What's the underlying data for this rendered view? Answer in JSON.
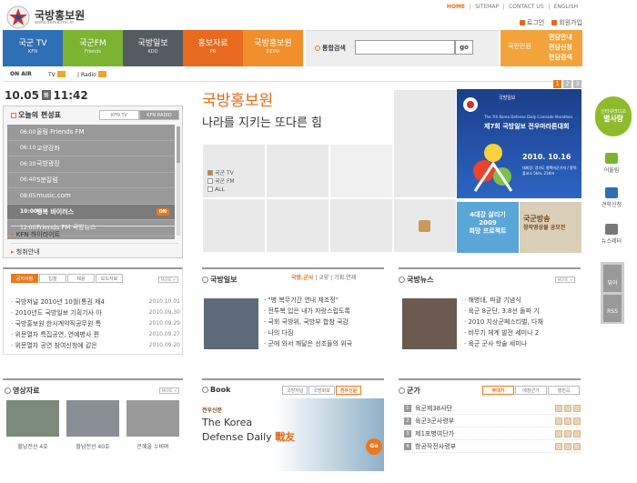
{
  "header": {
    "logo_text": "국방홍보원",
    "logo_url": "www.dema.mil.kr",
    "topnav": [
      "HOME",
      "SITEMAP",
      "CONTACT US",
      "ENGLISH"
    ],
    "login": "로그인",
    "join": "회원가입"
  },
  "menu": [
    {
      "label": "국군 TV",
      "sub": "KFN",
      "color": "#2f6fb5"
    },
    {
      "label": "국군FM",
      "sub": "Friends",
      "color": "#7cb432"
    },
    {
      "label": "국방일보",
      "sub": "KDD",
      "color": "#555b63"
    },
    {
      "label": "홍보자료",
      "sub": "PR",
      "color": "#e86a1e"
    },
    {
      "label": "국방홍보원",
      "sub": "DEMA",
      "color": "#f08f2c"
    }
  ],
  "search": {
    "label": "통합검색",
    "placeholder": "",
    "go": "go"
  },
  "civil": {
    "label": "국민민원",
    "lines": [
      "면담안내",
      "면담신청",
      "면담검색"
    ]
  },
  "onair": {
    "label": "ON AIR",
    "tv": "TV",
    "radio": "Radio"
  },
  "datetime": {
    "date": "10.05",
    "weekday": "화",
    "time": "11:42"
  },
  "schedule": {
    "title": "오늘의 편성표",
    "tabs": [
      "KFN TV",
      "KFN RADIO"
    ],
    "rows": [
      {
        "time": "06:00",
        "title": "울림 Friends FM"
      },
      {
        "time": "06:10",
        "title": "교양강좌"
      },
      {
        "time": "06:30",
        "title": "국방광장"
      },
      {
        "time": "06:40",
        "title": "5분칼럼"
      },
      {
        "time": "08:05",
        "title": "music.com"
      },
      {
        "time": "10:00",
        "title": "행복 바이러스",
        "badge": "ON"
      },
      {
        "time": "12:00",
        "title": "Friends FM 국방뉴스"
      }
    ],
    "links": [
      "KFN 하이라이트",
      "청취안내"
    ]
  },
  "hero": {
    "title": "국방홍보원",
    "subtitle": "나라를 지키는 또다른 힘",
    "filters": [
      "국군 TV",
      "국군 FM",
      "ALL"
    ],
    "pages": [
      "1",
      "2",
      "3"
    ],
    "poster1": {
      "org": "국방일보",
      "line1": "The 7th Korea Defense Daily Comrade Marathon",
      "line2": "제7회 국방일보 전우마라톤대회",
      "date": "2010. 10.16",
      "meta": "대회장: 경기도 평택미군기지 / 종목: 풀코스 5km, 21Km"
    },
    "poster2": {
      "line1": "4대강 살리기",
      "line2": "2009",
      "line3": "희망 프로젝트"
    },
    "poster3": {
      "line1": "국군방송",
      "line2": "창작영상물 공모전"
    }
  },
  "sidebar": {
    "radio_badge": {
      "line1": "인터넷라디오",
      "line2": "별사랑"
    },
    "items": [
      "어울림",
      "견학신청",
      "뉴스레터"
    ],
    "buttons": [
      "뷰어",
      "RSS"
    ]
  },
  "notice": {
    "tabs": [
      "공지사항",
      "입찰",
      "채용",
      "보도자료"
    ],
    "more": "MORE +",
    "items": [
      {
        "text": "국방저널 2010년 10월(통권 제4",
        "date": "2010.10.01"
      },
      {
        "text": "2010년도 국방일보 기획기사 아",
        "date": "2010.09.30"
      },
      {
        "text": "국방홍보원 한시계약직공무원 특",
        "date": "2010.09.29"
      },
      {
        "text": "위문열차 특집공연, 연예병사 편",
        "date": "2010.09.27"
      },
      {
        "text": "위문열차 공연 참여신청에 같은",
        "date": "2010.09.20"
      }
    ]
  },
  "paper": {
    "title": "국방일보",
    "cats": [
      "국방.군사",
      "교양",
      "기획.연재"
    ],
    "items": [
      "\"병 복무기간 연내 재조정\"",
      "전투복 입은 내가 자랑스럽도록",
      "국회 국방위, 국방부 합참 국감",
      "나의 다짐",
      "군에 와서 깨달은 선조들의 위국"
    ]
  },
  "news": {
    "title": "국방뉴스",
    "more": "MORE +",
    "items": [
      "해병대, 파괄 기념식",
      "육군 8군단, 3.8선 돌파 기",
      "2010 지상군페스티벌, 다채",
      "비무기 체계 발전 세미나 2",
      "육군 군사 학술 세미나"
    ]
  },
  "video": {
    "title": "영상자료",
    "more": "MORE +",
    "items": [
      "할남전선 4호",
      "할남전선 40호",
      "은혜을 누비며"
    ]
  },
  "book": {
    "title": "Book",
    "tabs": [
      "국방저널",
      "국방화보",
      "전우신문"
    ],
    "ad": {
      "small": "전우신문",
      "line1": "The Korea",
      "line2": "Defense Daily",
      "accent": "戰友",
      "go": "Go"
    }
  },
  "army": {
    "title": "군가",
    "tabs": [
      "부대가",
      "애창군가",
      "행진곡"
    ],
    "items": [
      {
        "n": "1",
        "text": "육군제38사단"
      },
      {
        "n": "2",
        "text": "육군3군사령부"
      },
      {
        "n": "3",
        "text": "제1포병여단가"
      },
      {
        "n": "4",
        "text": "항공작전사령부"
      }
    ]
  }
}
